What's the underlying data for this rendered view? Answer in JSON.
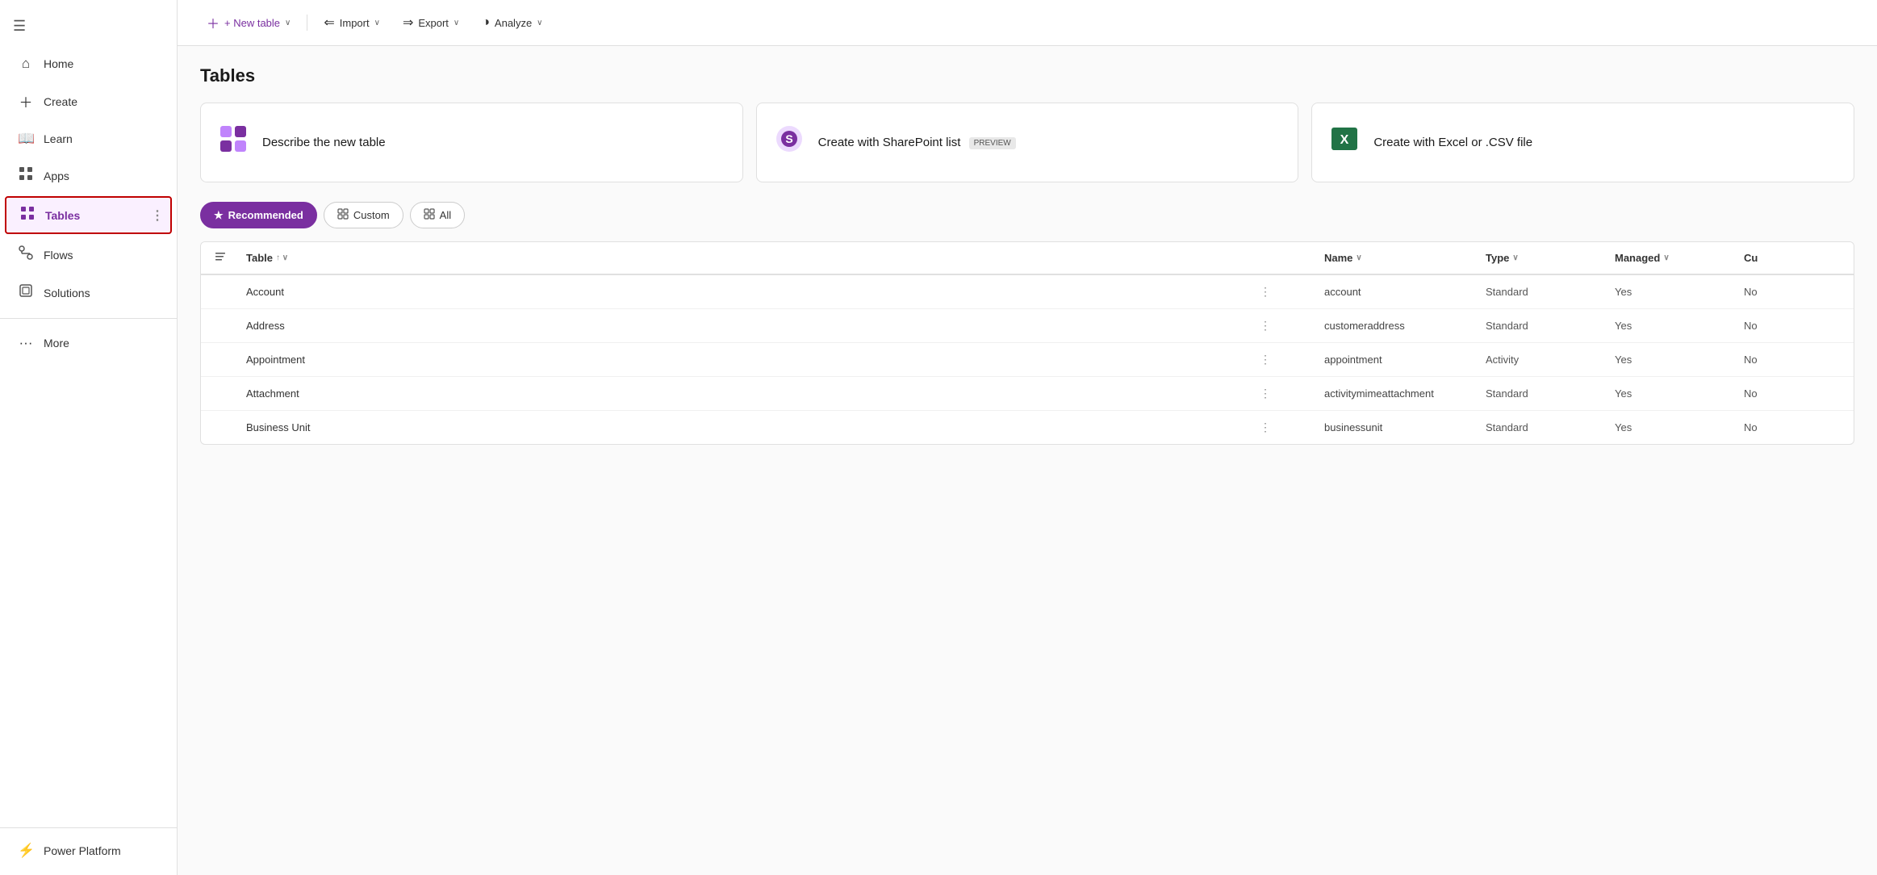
{
  "sidebar": {
    "hamburger_icon": "☰",
    "items": [
      {
        "id": "home",
        "label": "Home",
        "icon": "⌂",
        "active": false
      },
      {
        "id": "create",
        "label": "Create",
        "icon": "+",
        "active": false
      },
      {
        "id": "learn",
        "label": "Learn",
        "icon": "📖",
        "active": false
      },
      {
        "id": "apps",
        "label": "Apps",
        "icon": "⊞",
        "active": false
      },
      {
        "id": "tables",
        "label": "Tables",
        "icon": "⊞",
        "active": true
      },
      {
        "id": "flows",
        "label": "Flows",
        "icon": "⟳",
        "active": false
      },
      {
        "id": "solutions",
        "label": "Solutions",
        "icon": "⊡",
        "active": false
      },
      {
        "id": "more",
        "label": "More",
        "icon": "···",
        "active": false
      }
    ],
    "bottom_item": {
      "id": "power-platform",
      "label": "Power Platform",
      "icon": "⚡"
    }
  },
  "toolbar": {
    "new_table_label": "+ New table",
    "import_label": "Import",
    "export_label": "Export",
    "analyze_label": "Analyze",
    "chevron": "∨"
  },
  "page": {
    "title": "Tables"
  },
  "cards": [
    {
      "id": "describe-new-table",
      "icon_color": "#7a2fa0",
      "text": "Describe the new table"
    },
    {
      "id": "create-sharepoint",
      "icon_color": "#7a2fa0",
      "text": "Create with SharePoint list",
      "badge": "PREVIEW"
    },
    {
      "id": "create-excel",
      "icon_color": "#217346",
      "text": "Create with Excel or .CSV file"
    }
  ],
  "filter_tabs": [
    {
      "id": "recommended",
      "label": "Recommended",
      "icon": "★",
      "active": true
    },
    {
      "id": "custom",
      "label": "Custom",
      "icon": "⊞",
      "active": false
    },
    {
      "id": "all",
      "label": "All",
      "icon": "⊞",
      "active": false
    }
  ],
  "table": {
    "columns": [
      {
        "id": "select",
        "label": ""
      },
      {
        "id": "table",
        "label": "Table",
        "sortable": true
      },
      {
        "id": "dots",
        "label": ""
      },
      {
        "id": "name",
        "label": "Name",
        "sortable": true
      },
      {
        "id": "type",
        "label": "Type",
        "sortable": true
      },
      {
        "id": "managed",
        "label": "Managed",
        "sortable": true
      },
      {
        "id": "cu",
        "label": "Cu"
      }
    ],
    "rows": [
      {
        "table": "Account",
        "name": "account",
        "type": "Standard",
        "managed": "Yes",
        "cu": "No"
      },
      {
        "table": "Address",
        "name": "customeraddress",
        "type": "Standard",
        "managed": "Yes",
        "cu": "No"
      },
      {
        "table": "Appointment",
        "name": "appointment",
        "type": "Activity",
        "managed": "Yes",
        "cu": "No"
      },
      {
        "table": "Attachment",
        "name": "activitymimeattachment",
        "type": "Standard",
        "managed": "Yes",
        "cu": "No"
      },
      {
        "table": "Business Unit",
        "name": "businessunit",
        "type": "Standard",
        "managed": "Yes",
        "cu": "No"
      }
    ]
  },
  "colors": {
    "accent": "#7a2fa0",
    "active_border": "#c00000",
    "star_color": "#fff"
  }
}
